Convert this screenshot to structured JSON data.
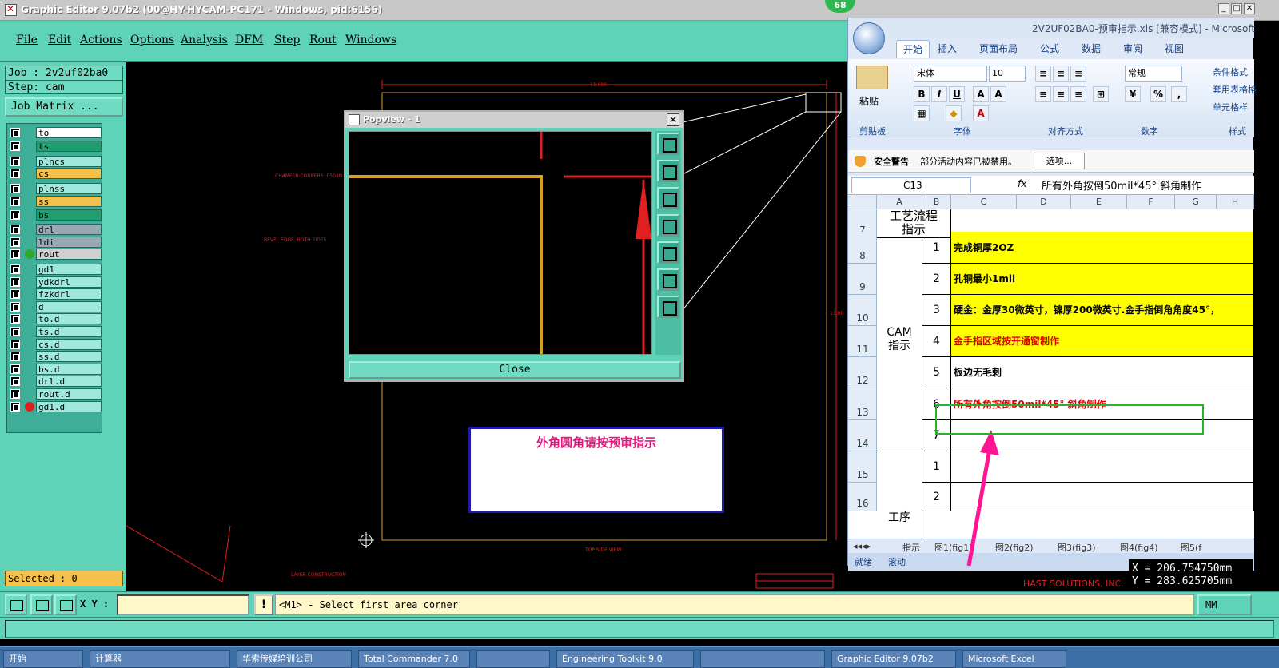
{
  "editor": {
    "title": "Graphic Editor 9.07b2 (00@HY-HYCAM-PC171 - Windows, pid:6156)",
    "badge": "68",
    "menu": [
      "File",
      "Edit",
      "Actions",
      "Options",
      "Analysis",
      "DFM",
      "Step",
      "Rout",
      "Windows"
    ],
    "job_label": "Job : 2v2uf02ba0",
    "step_label": "Step: cam",
    "job_matrix": "Job Matrix ...",
    "selected": "Selected : 0",
    "layers": [
      {
        "name": "to",
        "color": "#ffffff"
      },
      {
        "name": "ts",
        "color": "#1f9f6f"
      },
      {
        "name": "plncs",
        "color": "#9fe8dc"
      },
      {
        "name": "cs",
        "color": "#f4c24c"
      },
      {
        "name": "plnss",
        "color": "#9fe8dc"
      },
      {
        "name": "ss",
        "color": "#f4c24c"
      },
      {
        "name": "bs",
        "color": "#1f9f6f"
      },
      {
        "name": "drl",
        "color": "#9aa8b4"
      },
      {
        "name": "ldi",
        "color": "#9aa8b4"
      },
      {
        "name": "rout",
        "color": "#d0d0d0",
        "dot": "#2fa82f"
      },
      {
        "name": "gd1",
        "color": "#9fe8dc"
      },
      {
        "name": "ydkdrl",
        "color": "#9fe8dc"
      },
      {
        "name": "fzkdrl",
        "color": "#9fe8dc"
      },
      {
        "name": "d",
        "color": "#9fe8dc"
      },
      {
        "name": "to.d",
        "color": "#9fe8dc"
      },
      {
        "name": "ts.d",
        "color": "#9fe8dc"
      },
      {
        "name": "cs.d",
        "color": "#9fe8dc"
      },
      {
        "name": "ss.d",
        "color": "#9fe8dc"
      },
      {
        "name": "bs.d",
        "color": "#9fe8dc"
      },
      {
        "name": "drl.d",
        "color": "#9fe8dc"
      },
      {
        "name": "rout.d",
        "color": "#9fe8dc"
      },
      {
        "name": "gd1.d",
        "color": "#9fe8dc",
        "dot": "#e02020"
      }
    ],
    "canvas_text": {
      "dim_top": "11.000",
      "dim_right": "11.00",
      "chamfer": "CHAMFER CORNERS\n.050 IN. X 45 DEGREES",
      "bevel": "BEVEL EDGE, BOTH SIDES",
      "top_side": "TOP SIDE VIEW",
      "layer_construction": "LAYER CONSTRUCTION",
      "hast": "HAST SOLUTIONS, INC."
    },
    "popview": {
      "title": "Popview - 1",
      "close_label": "Close"
    },
    "note": "外角圆角请按预审指示",
    "xy_label": "X Y :",
    "xy_value": "",
    "command_message": "<M1> - Select first area corner",
    "unit": "MM",
    "coord_x": "X = 206.754750mm",
    "coord_y": "Y = 283.625705mm"
  },
  "taskbar": [
    "开始",
    "计算器",
    "华索传媒培训公司",
    "Total Commander 7.0",
    "",
    "Engineering Toolkit 9.0",
    "",
    "Graphic Editor 9.07b2",
    "Microsoft Excel"
  ],
  "excel": {
    "title": "2V2UF02BA0-预审指示.xls  [兼容模式] - Microsoft",
    "tabs": [
      "开始",
      "插入",
      "页面布局",
      "公式",
      "数据",
      "审阅",
      "视图"
    ],
    "paste": "粘贴",
    "font_name": "宋体",
    "font_size": "10",
    "number_format": "常规",
    "conditional": "条件格式",
    "table_format": "套用表格格",
    "cell_style": "单元格样",
    "groups": [
      "剪贴板",
      "字体",
      "对齐方式",
      "数字",
      "样式"
    ],
    "security_title": "安全警告",
    "security_msg": "部分活动内容已被禁用。",
    "options_btn": "选项...",
    "cell_ref": "C13",
    "formula": "所有外角按倒50mil*45° 斜角制作",
    "columns": [
      "A",
      "B",
      "C",
      "D",
      "E",
      "F",
      "G",
      "H"
    ],
    "process_label": "工艺流程\n指示",
    "cam_label": "CAM\n指示",
    "proc_label2": "工序",
    "rows": [
      {
        "row": "7",
        "num": "",
        "text": "",
        "yellow": false
      },
      {
        "row": "8",
        "num": "1",
        "text": "完成铜厚2OZ",
        "yellow": true
      },
      {
        "row": "9",
        "num": "2",
        "text": "孔铜最小1mil",
        "yellow": true
      },
      {
        "row": "10",
        "num": "3",
        "text": "硬金：金厚30微英寸，镍厚200微英寸.金手指倒角角度45°，",
        "yellow": true
      },
      {
        "row": "11",
        "num": "4",
        "text": "金手指区域按开通窗制作",
        "yellow": true,
        "red": true
      },
      {
        "row": "12",
        "num": "5",
        "text": "板边无毛刺",
        "yellow": false
      },
      {
        "row": "13",
        "num": "6",
        "text": "所有外角按倒50mil*45° 斜角制作",
        "yellow": false,
        "red": true
      },
      {
        "row": "14",
        "num": "7",
        "text": "",
        "yellow": false
      },
      {
        "row": "15",
        "num": "1",
        "text": "",
        "yellow": false
      },
      {
        "row": "16",
        "num": "2",
        "text": "",
        "yellow": false
      }
    ],
    "sheets": [
      "指示",
      "图1(fig1)",
      "图2(fig2)",
      "图3(fig3)",
      "图4(fig4)",
      "图5(f"
    ],
    "status_ready": "就绪",
    "status_scroll": "滚动"
  }
}
